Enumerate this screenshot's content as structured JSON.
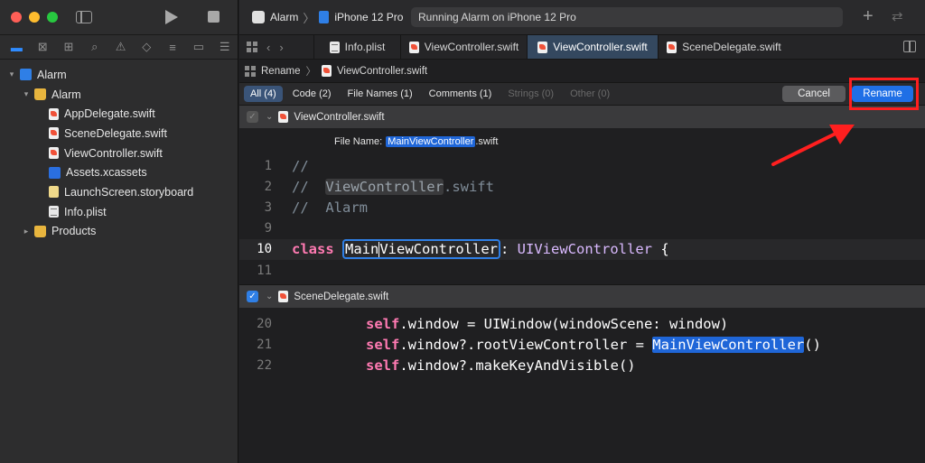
{
  "sidebar": {
    "tree": [
      {
        "label": "Alarm",
        "kind": "project",
        "indent": 0,
        "disclosure": "▾"
      },
      {
        "label": "Alarm",
        "kind": "folder",
        "indent": 1,
        "disclosure": "▾"
      },
      {
        "label": "AppDelegate.swift",
        "kind": "swift",
        "indent": 2
      },
      {
        "label": "SceneDelegate.swift",
        "kind": "swift",
        "indent": 2
      },
      {
        "label": "ViewController.swift",
        "kind": "swift",
        "indent": 2
      },
      {
        "label": "Assets.xcassets",
        "kind": "assets",
        "indent": 2
      },
      {
        "label": "LaunchScreen.storyboard",
        "kind": "storyboard",
        "indent": 2
      },
      {
        "label": "Info.plist",
        "kind": "plist",
        "indent": 2
      },
      {
        "label": "Products",
        "kind": "folder",
        "indent": 1,
        "disclosure": "▸"
      }
    ]
  },
  "toolbar": {
    "scheme": "Alarm",
    "device": "iPhone 12 Pro",
    "activity": "Running Alarm on iPhone 12 Pro"
  },
  "tabs": [
    {
      "label": "Info.plist",
      "kind": "plist",
      "active": false
    },
    {
      "label": "ViewController.swift",
      "kind": "swift",
      "active": false
    },
    {
      "label": "ViewController.swift",
      "kind": "swift",
      "active": true
    },
    {
      "label": "SceneDelegate.swift",
      "kind": "swift",
      "active": false
    }
  ],
  "jumpbar": {
    "action": "Rename",
    "file": "ViewController.swift"
  },
  "filters": [
    {
      "label": "All (4)",
      "state": "active"
    },
    {
      "label": "Code (2)",
      "state": "normal"
    },
    {
      "label": "File Names (1)",
      "state": "normal"
    },
    {
      "label": "Comments (1)",
      "state": "normal"
    },
    {
      "label": "Strings (0)",
      "state": "dim"
    },
    {
      "label": "Other (0)",
      "state": "dim"
    }
  ],
  "buttons": {
    "cancel": "Cancel",
    "rename": "Rename"
  },
  "file1": {
    "name": "ViewController.swift",
    "filename_label": "File Name:",
    "new_name": "MainViewController",
    "extension": ".swift",
    "lines": {
      "n1": "1",
      "t1": "//",
      "n2": "2",
      "t2a": "//  ",
      "t2b": "ViewController",
      "t2c": ".swift",
      "n3": "3",
      "t3": "//  Alarm",
      "n9": "9",
      "n10": "10",
      "kw": "class",
      "cls_a": "Main",
      "cls_b": "ViewController",
      "sep": ": ",
      "super": "UIViewController",
      "brace": " {",
      "n11": "11"
    }
  },
  "file2": {
    "name": "SceneDelegate.swift",
    "lines": {
      "n20": "20",
      "l20_kw": "self",
      "l20_rest": ".window = UIWindow(windowScene: window)",
      "n21": "21",
      "l21_kw": "self",
      "l21_rest": ".window?.rootViewController = ",
      "l21_sel": "MainViewController",
      "l21_end": "()",
      "n22": "22",
      "l22_kw": "self",
      "l22_rest": ".window?.makeKeyAndVisible()"
    }
  },
  "colors": {
    "accent": "#2f7fe6",
    "annotation": "#ff1f1f"
  }
}
